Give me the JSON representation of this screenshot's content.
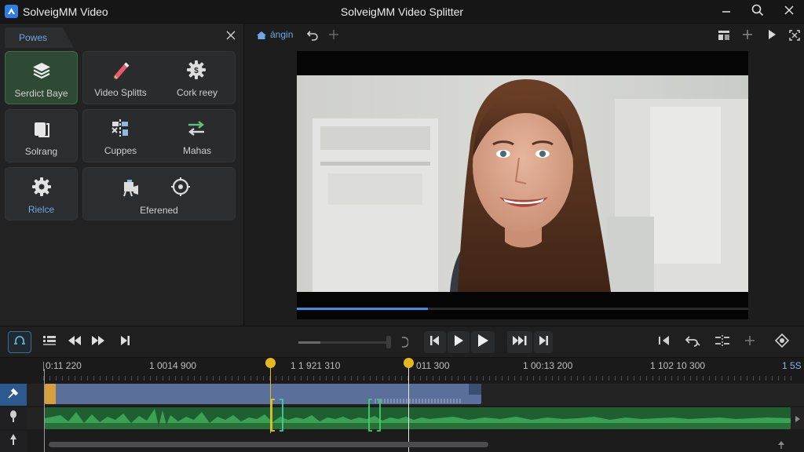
{
  "window": {
    "app_name": "SolveigMM Video",
    "title": "SolveigMM Video Splitter"
  },
  "colors": {
    "accent_blue": "#3d8fe0",
    "marker_yellow": "#e5b81c",
    "active_tile": "#2e4a35",
    "audio_wave": "#3fae5a"
  },
  "left_panel": {
    "tab_label": "Powes",
    "tiles": [
      {
        "label": "Serdict Baye",
        "icon": "layers-icon",
        "active": true
      },
      {
        "label": "Video Splitts",
        "icon": "pencil-icon",
        "active": false
      },
      {
        "label": "Cork reey",
        "icon": "gear-icon",
        "active": false
      },
      {
        "label": "Solrang",
        "icon": "copy-icon",
        "active": false
      },
      {
        "label": "Cuppes",
        "icon": "split-icon",
        "active": false
      },
      {
        "label": "Mahas",
        "icon": "swap-icon",
        "active": false
      },
      {
        "label": "Rielce",
        "icon": "settings-icon",
        "active": false
      },
      {
        "label": "Eferened",
        "icon": "effects-icon",
        "active": false
      }
    ]
  },
  "preview": {
    "tab_label": "ángin",
    "progress": 0.29
  },
  "transport": {
    "volume": 0.24
  },
  "timeline": {
    "ruler_labels": [
      "0:11 220",
      "1 0014 900",
      "1 1 921 310",
      "011 300",
      "1 00:13 200",
      "1 102 10 300",
      "1 5S"
    ],
    "markers": [
      {
        "name": "split-marker-1",
        "label": "1 1 921 310"
      },
      {
        "name": "split-marker-2",
        "label": "011 300"
      }
    ]
  }
}
